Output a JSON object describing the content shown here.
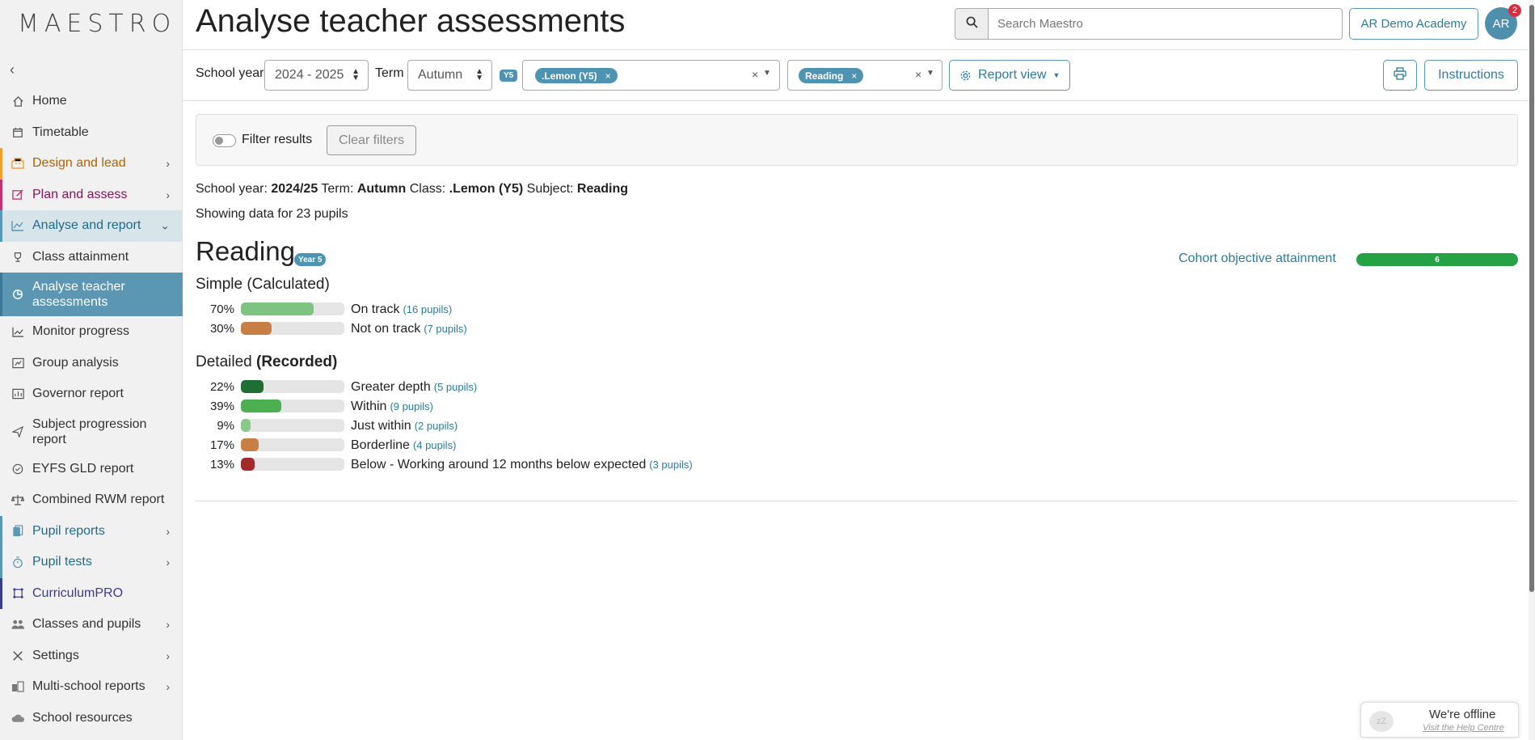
{
  "app": {
    "logo": "MAESTRO"
  },
  "sidebar": {
    "items": [
      {
        "label": "Home"
      },
      {
        "label": "Timetable"
      },
      {
        "label": "Design and lead"
      },
      {
        "label": "Plan and assess"
      },
      {
        "label": "Analyse and report"
      },
      {
        "label": "Class attainment"
      },
      {
        "label": "Analyse teacher assessments"
      },
      {
        "label": "Monitor progress"
      },
      {
        "label": "Group analysis"
      },
      {
        "label": "Governor report"
      },
      {
        "label": "Subject progression report"
      },
      {
        "label": "EYFS GLD report"
      },
      {
        "label": "Combined RWM report"
      },
      {
        "label": "Pupil reports"
      },
      {
        "label": "Pupil tests"
      },
      {
        "label": "CurriculumPRO"
      },
      {
        "label": "Classes and pupils"
      },
      {
        "label": "Settings"
      },
      {
        "label": "Multi-school reports"
      },
      {
        "label": "School resources"
      }
    ]
  },
  "header": {
    "title": "Analyse teacher assessments",
    "search_placeholder": "Search Maestro",
    "academy": "AR Demo Academy",
    "avatar_initials": "AR",
    "notification_count": "2"
  },
  "filters": {
    "school_year_label": "School year",
    "school_year_value": "2024 - 2025",
    "term_label": "Term",
    "term_value": "Autumn",
    "class_badge": "Y5",
    "class_chip": ".Lemon (Y5)",
    "subject_chip": "Reading",
    "report_view": "Report view",
    "instructions": "Instructions",
    "filter_results": "Filter results",
    "clear_filters": "Clear filters"
  },
  "summary": {
    "year_label": "School year:",
    "year_value": "2024/25",
    "term_label": "Term:",
    "term_value": "Autumn",
    "class_label": "Class:",
    "class_value": ".Lemon (Y5)",
    "subject_label": "Subject:",
    "subject_value": "Reading",
    "showing": "Showing data for 23 pupils"
  },
  "report": {
    "subject": "Reading",
    "year_badge": "Year 5",
    "cohort_label": "Cohort objective attainment",
    "cohort_value": "6",
    "simple_heading": "Simple",
    "simple_suffix": "(Calculated)",
    "simple_rows": [
      {
        "pct_label": "70%",
        "fraction": 0.7,
        "label": "On track",
        "count": "(16 pupils)",
        "color": "#7dc483"
      },
      {
        "pct_label": "30%",
        "fraction": 0.3,
        "label": "Not on track",
        "count": "(7 pupils)",
        "color": "#c87f45"
      }
    ],
    "detailed_heading": "Detailed",
    "detailed_suffix": "(Recorded)",
    "detailed_rows": [
      {
        "pct_label": "22%",
        "fraction": 0.22,
        "label": "Greater depth",
        "count": "(5 pupils)",
        "color": "#1f6e33"
      },
      {
        "pct_label": "39%",
        "fraction": 0.39,
        "label": "Within",
        "count": "(9 pupils)",
        "color": "#4caf50"
      },
      {
        "pct_label": "9%",
        "fraction": 0.09,
        "label": "Just within",
        "count": "(2 pupils)",
        "color": "#86c98a"
      },
      {
        "pct_label": "17%",
        "fraction": 0.17,
        "label": "Borderline",
        "count": "(4 pupils)",
        "color": "#c87f45"
      },
      {
        "pct_label": "13%",
        "fraction": 0.13,
        "label": "Below - Working around 12 months below expected",
        "count": "(3 pupils)",
        "color": "#a32a2a"
      }
    ]
  },
  "offline_widget": {
    "title": "We're offline",
    "link": "Visit the Help Centre"
  }
}
